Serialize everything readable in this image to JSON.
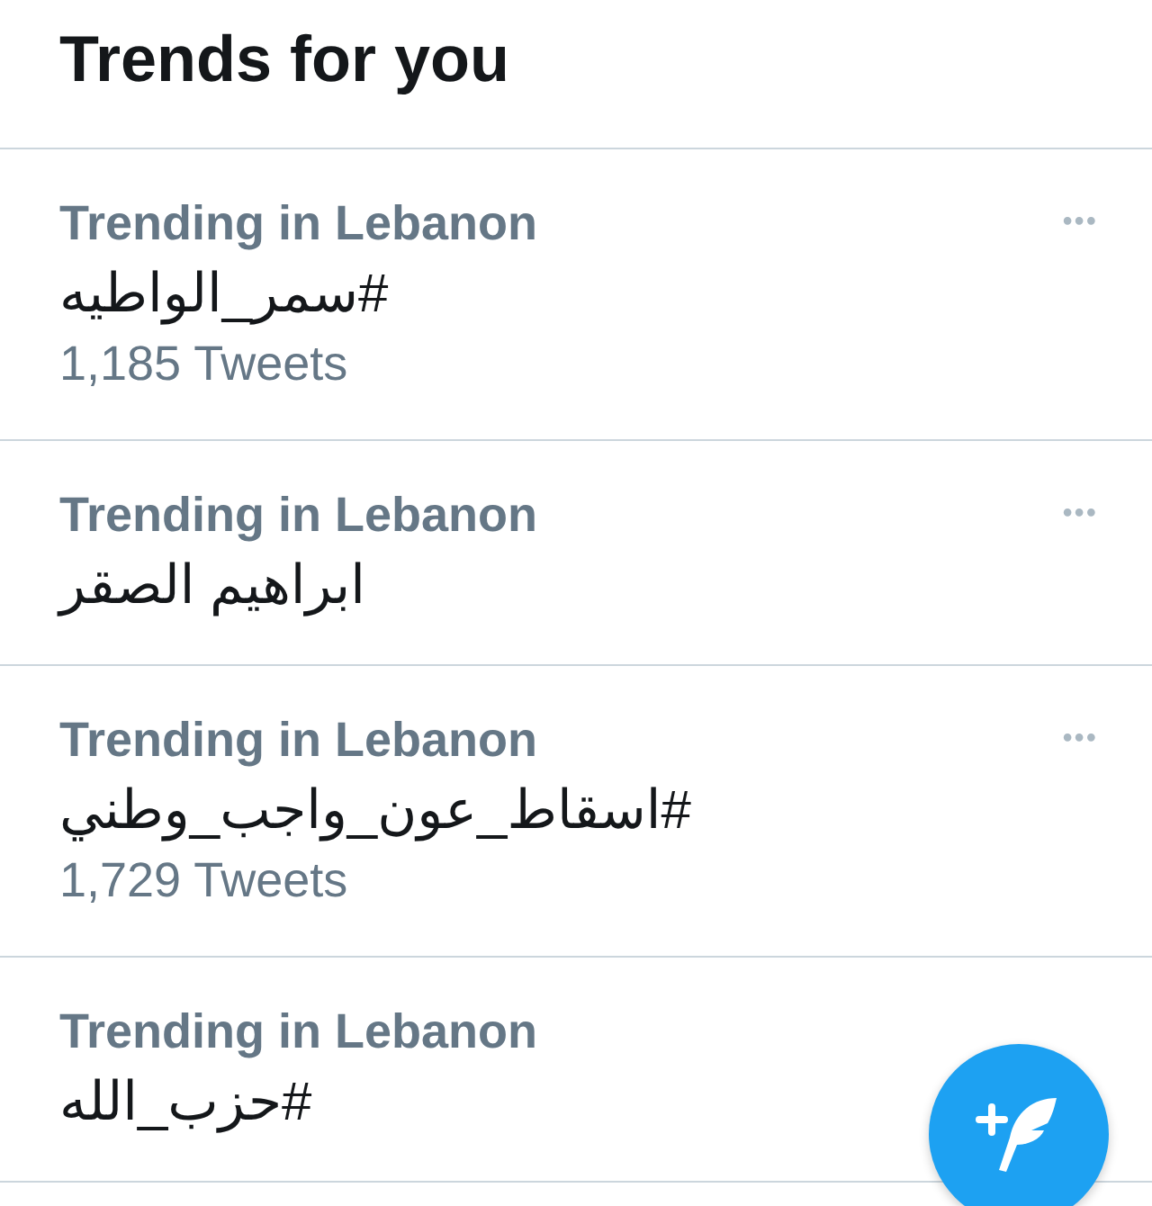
{
  "header": {
    "title": "Trends for you"
  },
  "trends": [
    {
      "context": "Trending in Lebanon",
      "topic": "#سمر_الواطيه",
      "count": "1,185 Tweets",
      "more": "•••"
    },
    {
      "context": "Trending in Lebanon",
      "topic": "ابراهيم الصقر",
      "more": "•••"
    },
    {
      "context": "Trending in Lebanon",
      "topic": "#اسقاط_عون_واجب_وطني",
      "count": "1,729 Tweets",
      "more": "•••"
    },
    {
      "context": "Trending in Lebanon",
      "topic": "#حزب_الله"
    }
  ],
  "compose_button": {
    "kind": "fab"
  }
}
